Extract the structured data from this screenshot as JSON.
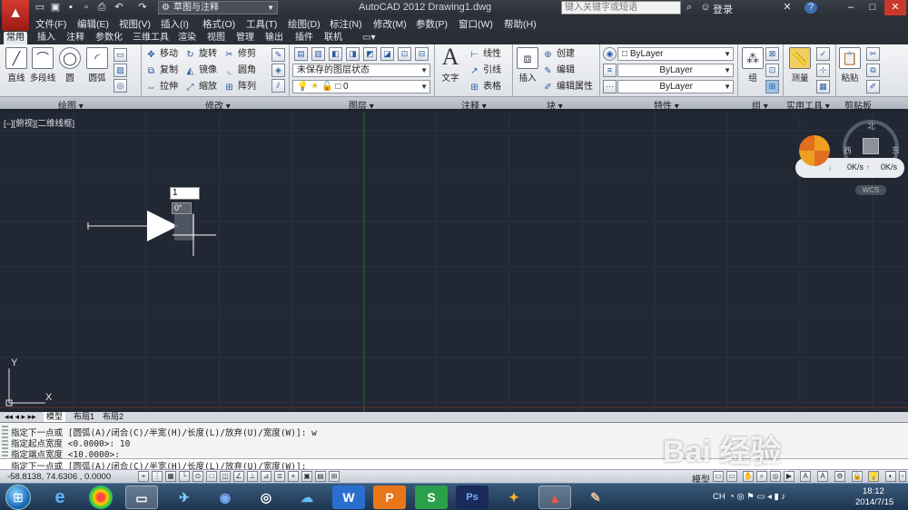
{
  "titlebar": {
    "title": "AutoCAD 2012    Drawing1.dwg",
    "workspace": "草图与注释",
    "search_placeholder": "键入关键字或短语",
    "login": "登录",
    "help": "?",
    "minimize": "–",
    "maximize": "□",
    "close": "✕"
  },
  "menu": [
    "文件(F)",
    "编辑(E)",
    "视图(V)",
    "插入(I)",
    "格式(O)",
    "工具(T)",
    "绘图(D)",
    "标注(N)",
    "修改(M)",
    "参数(P)",
    "窗口(W)",
    "帮助(H)"
  ],
  "ribbon_tabs": [
    "常用",
    "插入",
    "注释",
    "参数化",
    "三维工具",
    "渲染",
    "视图",
    "管理",
    "输出",
    "插件",
    "联机"
  ],
  "ribbon": {
    "draw": {
      "line": "直线",
      "polyline": "多段线",
      "circle": "圆",
      "arc": "圆弧"
    },
    "modify": {
      "move": "移动",
      "rotate": "旋转",
      "trim": "修剪",
      "copy": "复制",
      "mirror": "镜像",
      "fillet": "圆角",
      "stretch": "拉伸",
      "scale": "缩放",
      "array": "阵列"
    },
    "layer": {
      "state": "未保存的图层状态",
      "current": "0"
    },
    "annotation": {
      "text": "文字",
      "dimension": "线性",
      "leader": "引线",
      "table": "表格"
    },
    "block": {
      "insert": "插入",
      "create": "创建",
      "edit": "编辑",
      "edit_attr": "编辑属性"
    },
    "properties": {
      "color": "ByLayer",
      "linetype": "ByLayer",
      "lineweight": "ByLayer"
    },
    "groups": {
      "group": "组"
    },
    "utilities": {
      "measure": "测量"
    },
    "clipboard": {
      "paste": "粘贴"
    },
    "panel_titles": [
      "绘图",
      "修改",
      "图层",
      "注释",
      "块",
      "特性",
      "组",
      "实用工具",
      "剪贴板"
    ]
  },
  "canvas": {
    "view_label": "[–][俯视][二维线框]",
    "dyn_input_value": "1",
    "dyn_input_angle": "0°",
    "viewcube": {
      "north": "北",
      "west": "西",
      "east": "东",
      "wcs": "WCS"
    },
    "net_up": "0K/s",
    "net_down": "0K/s",
    "ucs_x": "X",
    "ucs_y": "Y"
  },
  "layout_tabs": [
    "模型",
    "布局1",
    "布局2"
  ],
  "command_lines": [
    "指定下一点或 [圆弧(A)/闭合(C)/半宽(H)/长度(L)/放弃(U)/宽度(W)]: w",
    "指定起点宽度 <0.0000>: 10",
    "指定端点宽度 <10.0000>:",
    "指定下一点或 [圆弧(A)/闭合(C)/半宽(H)/长度(L)/放弃(U)/宽度(W)]:"
  ],
  "status": {
    "coords": "-58.8138,  74.6306 , 0.0000",
    "model": "模型"
  },
  "taskbar": {
    "lang": "CH",
    "time": "18:12",
    "date": "2014/7/15"
  },
  "watermark": {
    "brand": "Bai 经验",
    "url": "jingyan.baidu.com"
  }
}
